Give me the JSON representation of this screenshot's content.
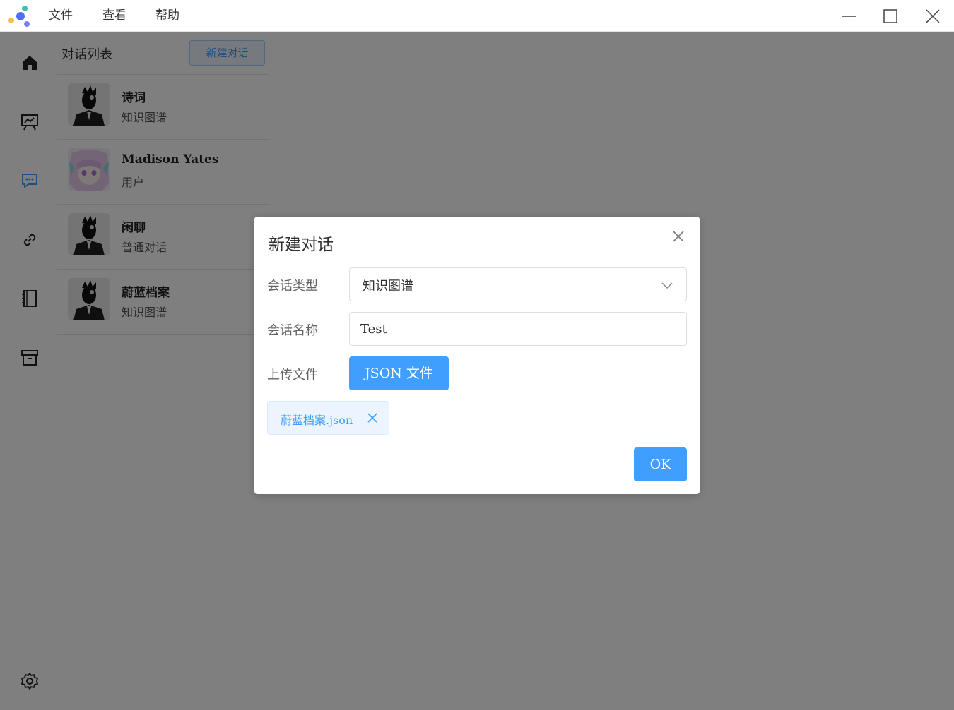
{
  "titlebar": {
    "menus": [
      "文件",
      "查看",
      "帮助"
    ],
    "icons": [
      "app-logo-icon",
      "minimize-icon",
      "maximize-icon",
      "close-icon"
    ]
  },
  "rail": {
    "items": [
      {
        "icon": "home-icon",
        "active": false
      },
      {
        "icon": "presentation-chart-icon",
        "active": false
      },
      {
        "icon": "chat-bubble-icon",
        "active": true
      },
      {
        "icon": "link-icon",
        "active": false
      },
      {
        "icon": "notebook-icon",
        "active": false
      },
      {
        "icon": "archive-box-icon",
        "active": false
      }
    ],
    "bottom_icon": "settings-gear-icon"
  },
  "convlist": {
    "title": "对话列表",
    "new_button": "新建对话",
    "items": [
      {
        "name": "诗词",
        "type": "知识图谱",
        "avatar": "masked-figure"
      },
      {
        "name": "Madison Yates",
        "type": "用户",
        "avatar": "anime-girl"
      },
      {
        "name": "闲聊",
        "type": "普通对话",
        "avatar": "masked-figure"
      },
      {
        "name": "蔚蓝档案",
        "type": "知识图谱",
        "avatar": "masked-figure"
      }
    ]
  },
  "dialog": {
    "title": "新建对话",
    "type_label": "会话类型",
    "type_value": "知识图谱",
    "name_label": "会话名称",
    "name_value": "Test",
    "upload_label": "上传文件",
    "upload_button": "JSON 文件",
    "file_name": "蔚蓝档案.json",
    "ok_button": "OK"
  },
  "colors": {
    "accent": "#409eff",
    "overlay": "rgba(0,0,0,0.5)",
    "active_icon": "#409eff"
  }
}
